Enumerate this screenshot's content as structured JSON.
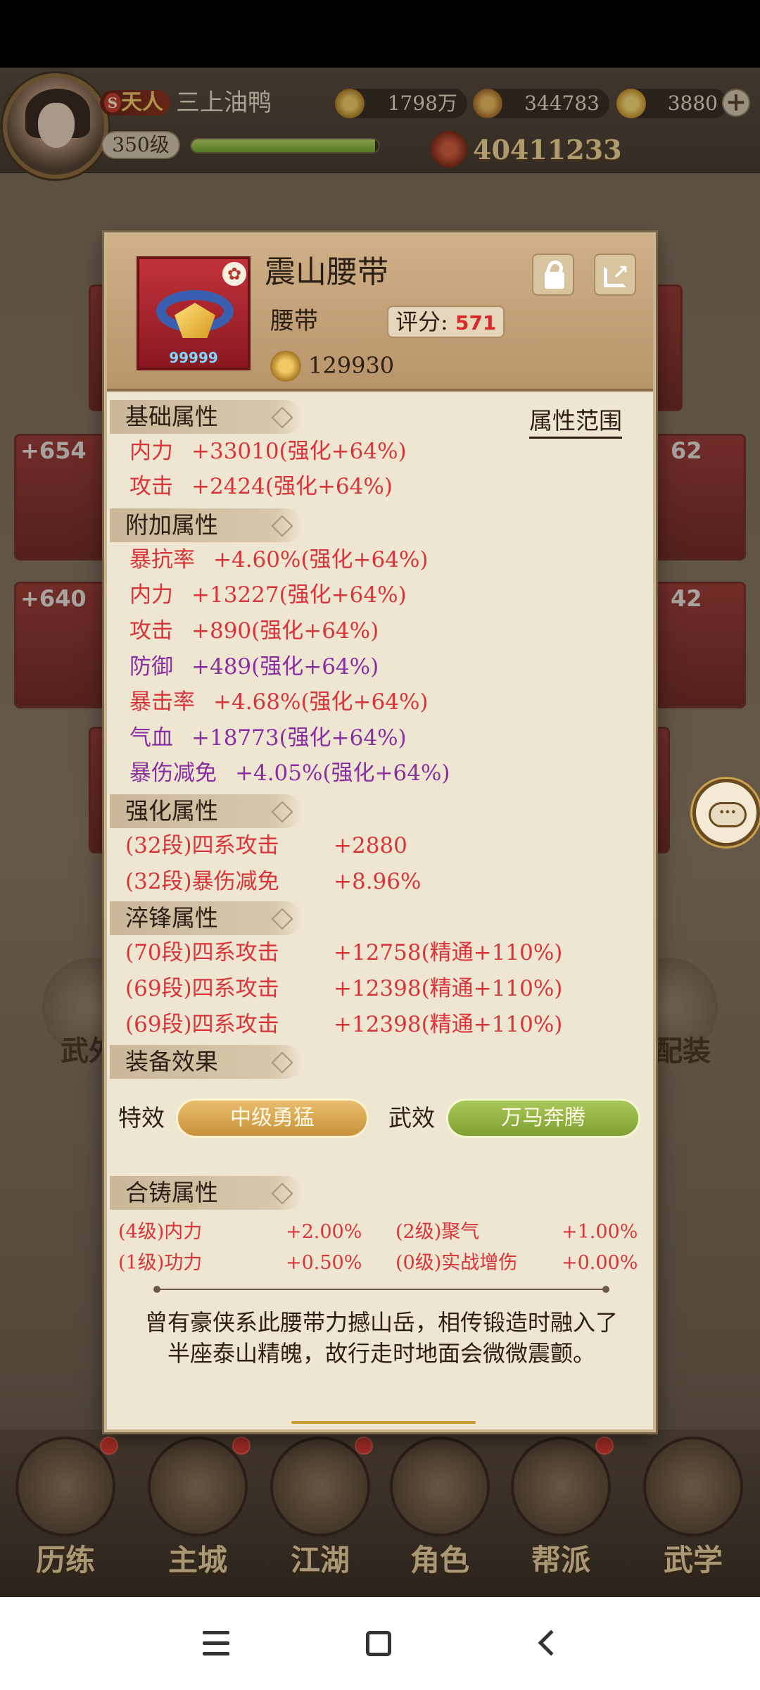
{
  "player": {
    "rank_prefix": "S",
    "rank": "天人",
    "name": "三上油鸭",
    "level": "350级",
    "exp_fraction": 0.98,
    "power": "40411233"
  },
  "resources": {
    "coins": "1798万",
    "ingots": "344783",
    "gold": "3880",
    "plus_icon": "plus-icon"
  },
  "background": {
    "tiles": [
      "+654",
      "+640",
      "62",
      "42"
    ],
    "side_left": "武外",
    "side_right": "配装",
    "nav": [
      {
        "label": "历练",
        "icon": "training-icon",
        "dot": true
      },
      {
        "label": "主城",
        "icon": "city-icon",
        "dot": true
      },
      {
        "label": "江湖",
        "icon": "jianghu-icon",
        "dot": true
      },
      {
        "label": "角色",
        "icon": "character-icon",
        "dot": false
      },
      {
        "label": "帮派",
        "icon": "guild-icon",
        "dot": true
      },
      {
        "label": "武学",
        "icon": "martial-arts-icon",
        "dot": false
      }
    ]
  },
  "item": {
    "name": "震山腰带",
    "type": "腰带",
    "score_label": "评分:",
    "score": "571",
    "power": "129930",
    "stars": "99999",
    "badge_icon": "flower-icon",
    "colors": {
      "frame": "#c2323a",
      "accent": "#d42a2a"
    }
  },
  "sections": {
    "basic": "基础属性",
    "attr_range": "属性范围",
    "extra": "附加属性",
    "enhance": "强化属性",
    "temper": "淬锋属性",
    "effect": "装备效果",
    "cast": "合铸属性"
  },
  "basic_attrs": [
    {
      "name": "内力",
      "value": "+33010(强化+64%)"
    },
    {
      "name": "攻击",
      "value": "+2424(强化+64%)"
    }
  ],
  "extra_attrs": [
    {
      "name": "暴抗率",
      "value": "+4.60%(强化+64%)",
      "color": "red"
    },
    {
      "name": "内力",
      "value": "+13227(强化+64%)",
      "color": "red"
    },
    {
      "name": "攻击",
      "value": "+890(强化+64%)",
      "color": "red"
    },
    {
      "name": "防御",
      "value": "+489(强化+64%)",
      "color": "purple"
    },
    {
      "name": "暴击率",
      "value": "+4.68%(强化+64%)",
      "color": "red"
    },
    {
      "name": "气血",
      "value": "+18773(强化+64%)",
      "color": "purple"
    },
    {
      "name": "暴伤减免",
      "value": "+4.05%(强化+64%)",
      "color": "purple"
    }
  ],
  "enhance_attrs": [
    {
      "name": "(32段)四系攻击",
      "value": "+2880"
    },
    {
      "name": "(32段)暴伤减免",
      "value": "+8.96%"
    }
  ],
  "temper_attrs": [
    {
      "name": "(70段)四系攻击",
      "value": "+12758(精通+110%)"
    },
    {
      "name": "(69段)四系攻击",
      "value": "+12398(精通+110%)"
    },
    {
      "name": "(69段)四系攻击",
      "value": "+12398(精通+110%)"
    }
  ],
  "effects": {
    "special_label": "特效",
    "special_value": "中级勇猛",
    "martial_label": "武效",
    "martial_value": "万马奔腾"
  },
  "cast_attrs": [
    {
      "name": "(4级)内力",
      "value": "+2.00%"
    },
    {
      "name": "(2级)聚气",
      "value": "+1.00%"
    },
    {
      "name": "(1级)功力",
      "value": "+0.50%"
    },
    {
      "name": "(0级)实战增伤",
      "value": "+0.00%"
    }
  ],
  "description": "曾有豪侠系此腰带力撼山岳，相传锻造时融入了半座泰山精魄，故行走时地面会微微震颤。"
}
